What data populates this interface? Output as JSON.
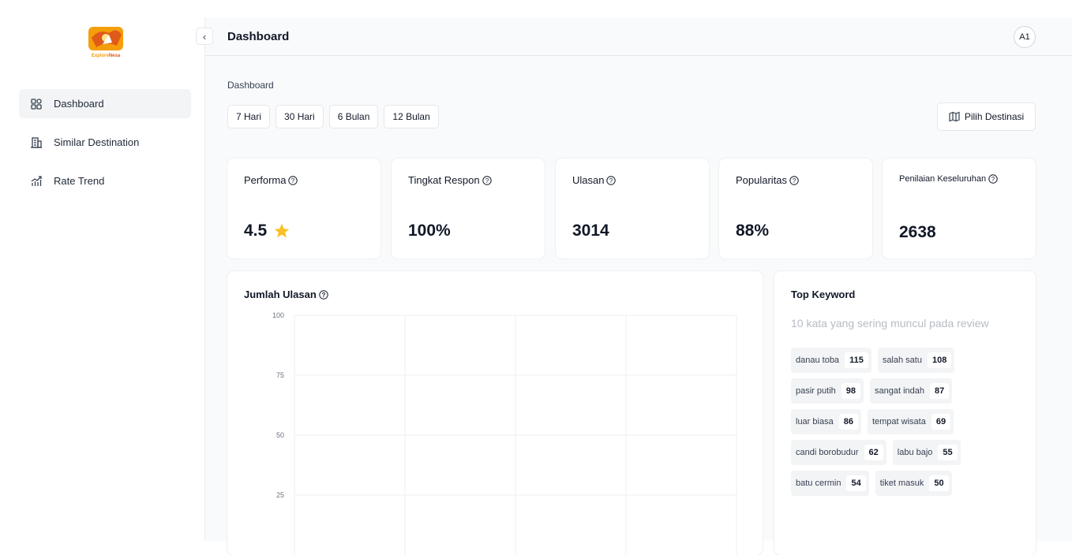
{
  "brand": {
    "logo_text_a": "Explore",
    "logo_text_b": "Nesa",
    "colors": {
      "primary": "#e05a1a",
      "secondary": "#f59e0b"
    }
  },
  "sidebar": {
    "items": [
      {
        "label": "Dashboard",
        "icon": "grid-icon",
        "active": true
      },
      {
        "label": "Similar Destination",
        "icon": "building-icon",
        "active": false
      },
      {
        "label": "Rate Trend",
        "icon": "trend-chart-icon",
        "active": false
      }
    ]
  },
  "header": {
    "title": "Dashboard",
    "avatar_text": "A1",
    "collapse_icon": "chevron-left-icon"
  },
  "breadcrumb": "Dashboard",
  "filters": [
    "7 Hari",
    "30 Hari",
    "6 Bulan",
    "12 Bulan"
  ],
  "destination_button": {
    "label": "Pilih Destinasi",
    "icon": "map-icon"
  },
  "stats": [
    {
      "label": "Performa",
      "value": "4.5",
      "has_star": true
    },
    {
      "label": "Tingkat Respon",
      "value": "100%"
    },
    {
      "label": "Ulasan",
      "value": "3014"
    },
    {
      "label": "Popularitas",
      "value": "88%"
    },
    {
      "label": "Penilaian Keseluruhan",
      "value": "2638"
    }
  ],
  "chart_data": {
    "type": "line",
    "title": "Jumlah Ulasan",
    "x": [],
    "series": [],
    "yticks": [
      100,
      75,
      50,
      25
    ],
    "ylim": [
      0,
      100
    ],
    "grid": true,
    "xlabel": "",
    "ylabel": ""
  },
  "keywords": {
    "title": "Top Keyword",
    "subtitle": "10 kata yang sering muncul pada review",
    "items": [
      {
        "word": "danau toba",
        "count": "115"
      },
      {
        "word": "salah satu",
        "count": "108"
      },
      {
        "word": "pasir putih",
        "count": "98"
      },
      {
        "word": "sangat indah",
        "count": "87"
      },
      {
        "word": "luar biasa",
        "count": "86"
      },
      {
        "word": "tempat wisata",
        "count": "69"
      },
      {
        "word": "candi borobudur",
        "count": "62"
      },
      {
        "word": "labu bajo",
        "count": "55"
      },
      {
        "word": "batu cermin",
        "count": "54"
      },
      {
        "word": "tiket masuk",
        "count": "50"
      }
    ]
  }
}
